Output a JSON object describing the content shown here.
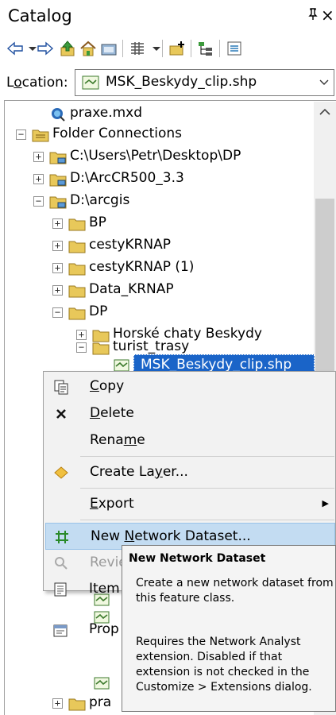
{
  "titlebar": {
    "title": "Catalog",
    "pin": "ᵖ",
    "close": "×"
  },
  "location": {
    "label_pre": "L",
    "label_under": "o",
    "label_post": "cation:",
    "value": "MSK_Beskydy_clip.shp"
  },
  "tree": {
    "praxe": "praxe.mxd",
    "folder_connections": "Folder Connections",
    "dp_desktop": "C:\\Users\\Petr\\Desktop\\DP",
    "arccr": "D:\\ArcCR500_3.3",
    "arcgis": "D:\\arcgis",
    "bp": "BP",
    "cesty1": "cestyKRNAP",
    "cesty2": "cestyKRNAP (1)",
    "data_krnap": "Data_KRNAP",
    "dp": "DP",
    "horske": "Horské chaty Beskydy",
    "turist": "turist_trasy",
    "selected": "MSK_Beskydy_clip.shp",
    "pra": "pra"
  },
  "menu": {
    "copy_u": "C",
    "copy_rest": "opy",
    "delete_u": "D",
    "delete_rest": "elete",
    "rename_pre": "Rena",
    "rename_u": "m",
    "rename_post": "e",
    "create_pre": "Create La",
    "create_u": "y",
    "create_post": "er...",
    "export_u": "E",
    "export_rest": "xport",
    "netds_pre": "New ",
    "netds_u": "N",
    "netds_post": "etwork Dataset...",
    "review": "Review/Rematch Addresses",
    "item": "Item",
    "prop": "Prop"
  },
  "tooltip": {
    "title": "New Network Dataset",
    "body": "Create a new network dataset from this feature class.",
    "body2": "Requires the Network Analyst extension. Disabled if that extension is not checked in the Customize > Extensions dialog."
  },
  "colors": {
    "selection": "#1a64c8",
    "menu_hover": "#c3dcf2",
    "folder": "#e8c85a"
  }
}
